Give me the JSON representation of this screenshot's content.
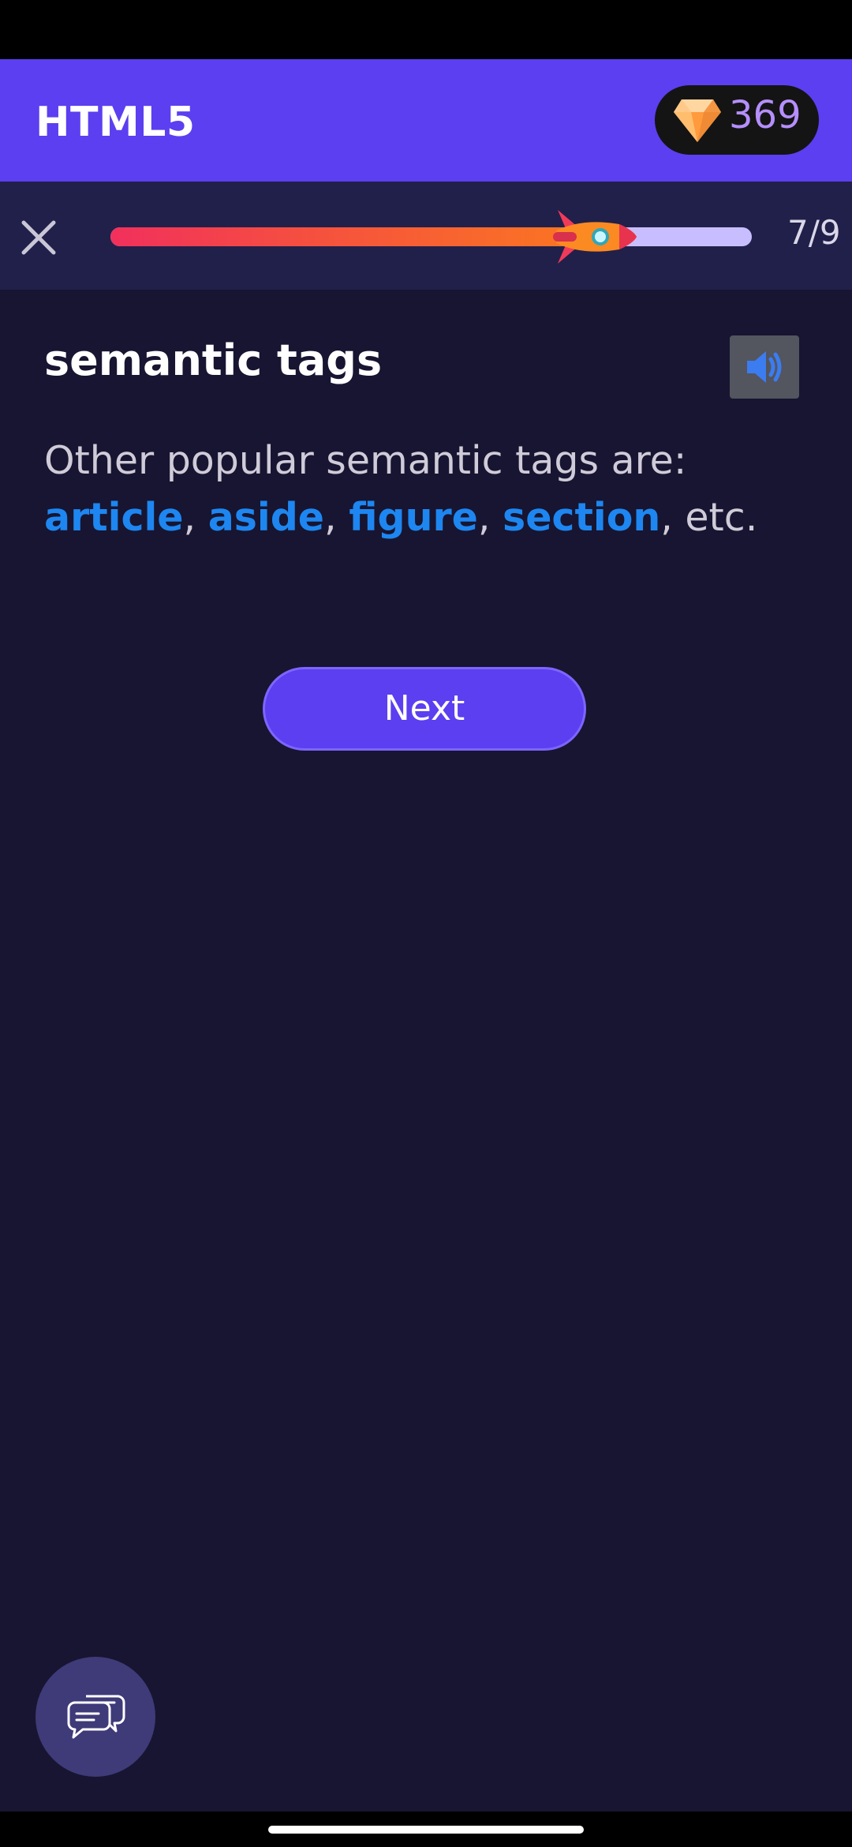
{
  "header": {
    "title": "HTML5",
    "gems": "369",
    "gem_icon": "diamond-icon"
  },
  "progress": {
    "current_text": "7/9",
    "fraction": 0.78,
    "close_icon": "close-icon",
    "rocket_icon": "rocket-icon"
  },
  "lesson": {
    "title": "semantic tags",
    "text_intro": "Other popular semantic tags are:",
    "tags": [
      "article",
      "aside",
      "figure",
      "section"
    ],
    "sep": ", ",
    "text_outro": ", etc.",
    "audio_icon": "speaker-icon"
  },
  "actions": {
    "next_label": "Next"
  },
  "chat": {
    "icon": "chat-bubbles-icon"
  },
  "colors": {
    "header_bg": "#5b3ff0",
    "page_bg": "#171531",
    "link": "#1e86f0",
    "progress_start": "#f1305c",
    "progress_end": "#fb7a1e"
  }
}
